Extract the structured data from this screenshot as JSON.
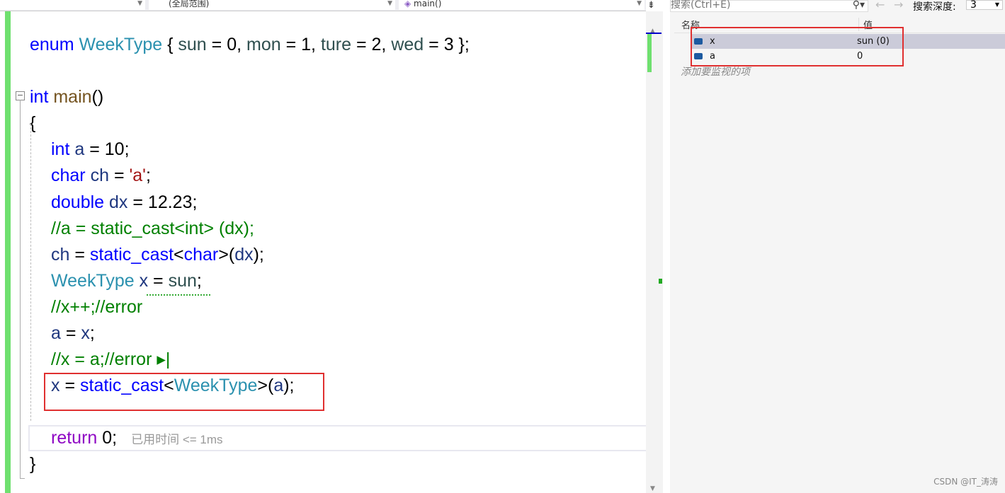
{
  "toolbar": {
    "scope_combo": "(全局范围)",
    "function_combo": "main()"
  },
  "code": [
    {
      "indent": 0,
      "tokens": [
        [
          "enum ",
          "kw"
        ],
        [
          "WeekType",
          "ty"
        ],
        [
          " { ",
          "pl"
        ],
        [
          "sun",
          "em"
        ],
        [
          " = 0, ",
          "pl"
        ],
        [
          "mon",
          "em"
        ],
        [
          " = 1, ",
          "pl"
        ],
        [
          "ture",
          "em"
        ],
        [
          " = 2, ",
          "pl"
        ],
        [
          "wed",
          "em"
        ],
        [
          " = 3 };",
          "pl"
        ]
      ]
    },
    {
      "indent": 0,
      "tokens": []
    },
    {
      "indent": 0,
      "tokens": [
        [
          "int ",
          "kw"
        ],
        [
          "main",
          "fn"
        ],
        [
          "()",
          "pl"
        ]
      ]
    },
    {
      "indent": 0,
      "tokens": [
        [
          "{",
          "pl"
        ]
      ]
    },
    {
      "indent": 1,
      "tokens": [
        [
          "int ",
          "kw"
        ],
        [
          "a",
          "id"
        ],
        [
          " = 10;",
          "pl"
        ]
      ]
    },
    {
      "indent": 1,
      "tokens": [
        [
          "char ",
          "kw"
        ],
        [
          "ch",
          "id"
        ],
        [
          " = ",
          "pl"
        ],
        [
          "'a'",
          "st"
        ],
        [
          ";",
          "pl"
        ]
      ]
    },
    {
      "indent": 1,
      "tokens": [
        [
          "double ",
          "kw"
        ],
        [
          "dx",
          "id"
        ],
        [
          " = 12.23;",
          "pl"
        ]
      ]
    },
    {
      "indent": 1,
      "tokens": [
        [
          "//a = static_cast<int> (dx);",
          "cm"
        ]
      ]
    },
    {
      "indent": 1,
      "tokens": [
        [
          "ch",
          "id"
        ],
        [
          " = ",
          "pl"
        ],
        [
          "static_cast",
          "kw"
        ],
        [
          "<",
          "pl"
        ],
        [
          "char",
          "kw"
        ],
        [
          ">(",
          "pl"
        ],
        [
          "dx",
          "id"
        ],
        [
          ");",
          "pl"
        ]
      ]
    },
    {
      "indent": 1,
      "tokens": [
        [
          "WeekType ",
          "ty"
        ],
        [
          "x",
          "id"
        ],
        [
          " = ",
          "pl"
        ],
        [
          "sun",
          "em"
        ],
        [
          ";",
          "pl"
        ]
      ]
    },
    {
      "indent": 1,
      "tokens": [
        [
          "//x++;//error",
          "cm"
        ]
      ]
    },
    {
      "indent": 1,
      "tokens": [
        [
          "a",
          "id"
        ],
        [
          " = ",
          "pl"
        ],
        [
          "x",
          "id"
        ],
        [
          ";",
          "pl"
        ]
      ]
    },
    {
      "indent": 1,
      "tokens": [
        [
          "//x = a;//error ▸|",
          "cm"
        ]
      ]
    },
    {
      "indent": 1,
      "tokens": [
        [
          "x",
          "id"
        ],
        [
          " = ",
          "pl"
        ],
        [
          "static_cast",
          "kw"
        ],
        [
          "<",
          "pl"
        ],
        [
          "WeekType",
          "ty"
        ],
        [
          ">(",
          "pl"
        ],
        [
          "a",
          "id"
        ],
        [
          ");",
          "pl"
        ]
      ]
    },
    {
      "indent": 1,
      "tokens": []
    },
    {
      "indent": 1,
      "tokens": [
        [
          "return ",
          "rt"
        ],
        [
          "0;",
          "pl"
        ]
      ],
      "hint": "已用时间 <= 1ms"
    },
    {
      "indent": 0,
      "tokens": [
        [
          "}",
          "pl"
        ]
      ]
    }
  ],
  "watch": {
    "search_placeholder": "搜索(Ctrl+E)",
    "depth_label": "搜索深度:",
    "depth_value": "3",
    "col_name": "名称",
    "col_value": "值",
    "rows": [
      {
        "name": "x",
        "value": "sun (0)"
      },
      {
        "name": "a",
        "value": "0"
      }
    ],
    "add_item": "添加要监视的项"
  },
  "watermark": "CSDN @IT_涛涛",
  "colors": {
    "keyword": "#0000ff",
    "type": "#2b91af",
    "comment": "#008000",
    "highlight": "#e03030"
  }
}
